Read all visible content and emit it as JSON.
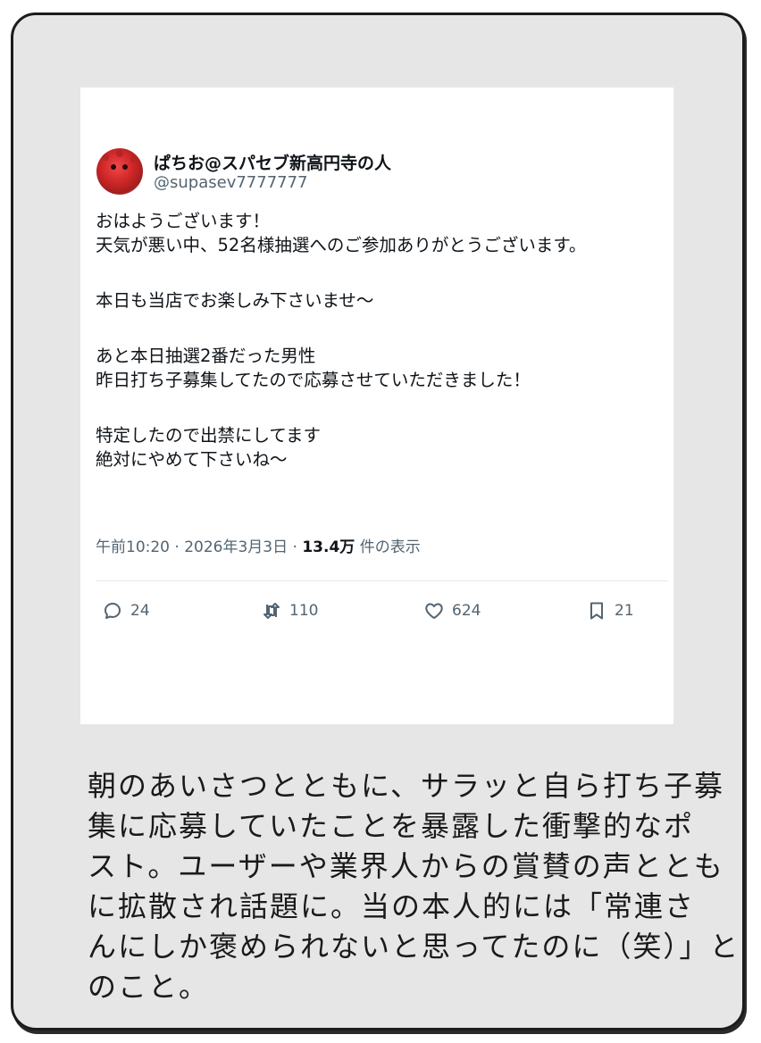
{
  "tweet": {
    "author_name": "ぱちお@スパセブ新高円寺の人",
    "author_handle": "@supasev7777777",
    "body_lines": [
      "おはようございます！",
      "天気が悪い中、52名様抽選へのご参加ありがとうございます。",
      "",
      "本日も当店でお楽しみ下さいませ〜",
      "",
      "あと本日抽選2番だった男性",
      "昨日打ち子募集してたので応募させていただきました！",
      "",
      "特定したので出禁にしてます",
      "絶対にやめて下さいね〜"
    ],
    "time": "午前10:20",
    "date": "2026年3月3日",
    "views_count": "13.4万",
    "views_label": "件の表示",
    "reply_count": "24",
    "retweet_count": "110",
    "like_count": "624",
    "bookmark_count": "21"
  },
  "caption_lines": [
    "朝のあいさつとともに、サラッと自ら打ち子募",
    "集に応募していたことを暴露した衝撃的なポ",
    "スト。ユーザーや業界人からの賞賛の声ととも",
    "に拡散され話題に。当の本人的には「常連さ",
    "んにしか褒められないと思ってたのに（笑）」と",
    "のこと。"
  ]
}
